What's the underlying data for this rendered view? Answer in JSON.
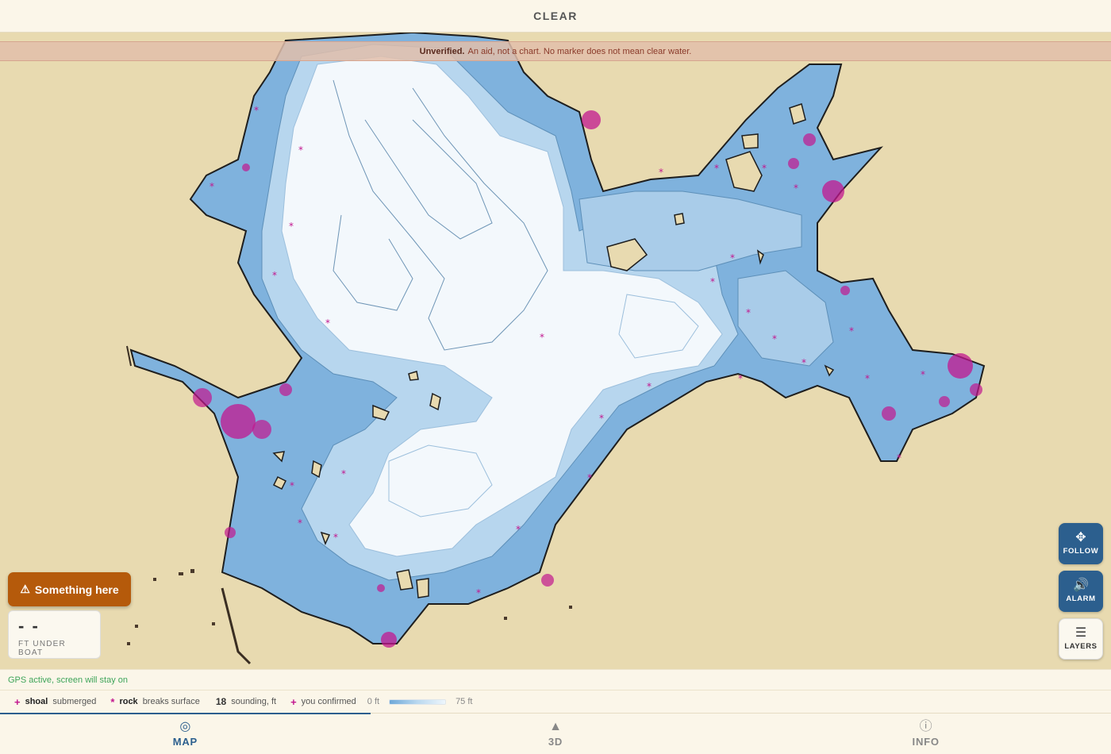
{
  "header": {
    "title": "CLEAR"
  },
  "banner": {
    "strong": "Unverified.",
    "text": "An aid, not a chart. No marker does not mean clear water."
  },
  "controls": {
    "follow": {
      "icon": "crosshair-move-icon",
      "label": "FOLLOW"
    },
    "alarm": {
      "icon": "speaker-icon",
      "label": "ALARM"
    },
    "layers": {
      "icon": "hamburger-icon",
      "label": "LAYERS"
    }
  },
  "alert": {
    "icon": "warning-icon",
    "label": "Something here"
  },
  "depth": {
    "value": "- -",
    "unit": "FT UNDER BOAT"
  },
  "gps_status": "GPS active, screen will stay on",
  "legend": {
    "shoal_symbol": "+",
    "shoal_label": "shoal",
    "shoal_desc": "submerged",
    "rock_symbol": "*",
    "rock_label": "rock",
    "rock_desc": "breaks surface",
    "sounding_value": "18",
    "sounding_desc": "sounding, ft",
    "confirmed_symbol": "+",
    "confirmed_desc": "you confirmed",
    "ramp_min": "0 ft",
    "ramp_max": "75 ft"
  },
  "tabs": [
    {
      "icon": "target-icon",
      "label": "MAP",
      "active": true
    },
    {
      "icon": "triangle-icon",
      "label": "3D",
      "active": false
    },
    {
      "icon": "info-icon",
      "label": "INFO",
      "active": false
    }
  ],
  "colors": {
    "land": "#e8dab0",
    "shallow": "#7fb2dd",
    "mid": "#b7d6ee",
    "deep": "#f3f8fc",
    "hazard": "#c2178f",
    "accent": "#2c5f8e",
    "alert": "#b55a0b"
  }
}
